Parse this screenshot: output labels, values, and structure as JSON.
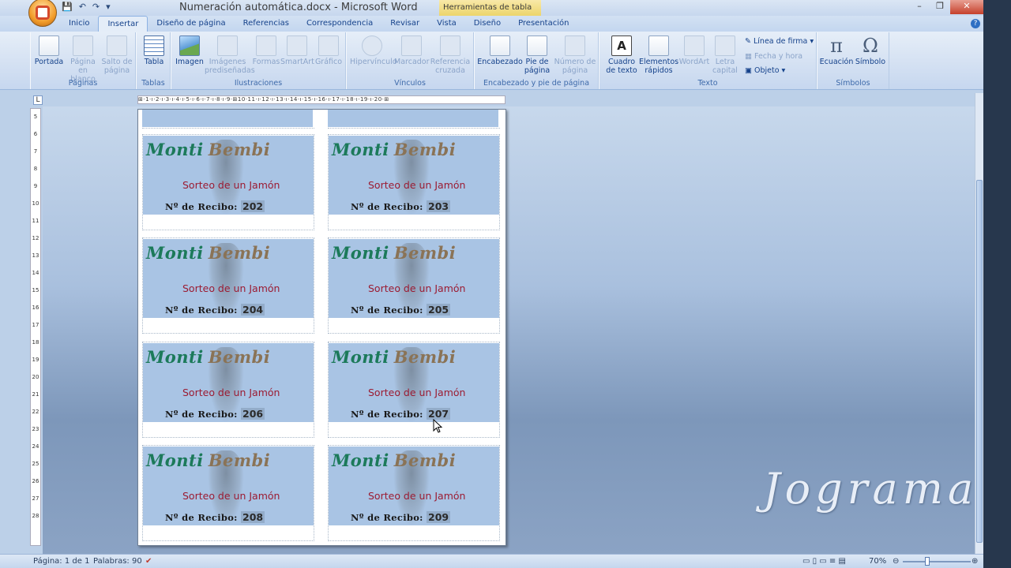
{
  "window": {
    "title": "Numeración automática.docx - Microsoft Word",
    "context_tab": "Herramientas de tabla",
    "controls": [
      "–",
      "❐",
      "✕"
    ]
  },
  "quick_access": [
    "💾",
    "↶",
    "↷",
    "▾"
  ],
  "tabs": [
    "Inicio",
    "Insertar",
    "Diseño de página",
    "Referencias",
    "Correspondencia",
    "Revisar",
    "Vista",
    "Diseño",
    "Presentación"
  ],
  "active_tab": "Insertar",
  "ribbon": {
    "groups": {
      "paginas": {
        "label": "Páginas",
        "buttons": [
          "Portada",
          "Página en blanco",
          "Salto de página"
        ]
      },
      "tablas": {
        "label": "Tablas",
        "buttons": [
          "Tabla"
        ]
      },
      "ilustraciones": {
        "label": "Ilustraciones",
        "buttons": [
          "Imagen",
          "Imágenes prediseñadas",
          "Formas",
          "SmartArt",
          "Gráfico"
        ]
      },
      "vinculos": {
        "label": "Vínculos",
        "buttons": [
          "Hipervínculo",
          "Marcador",
          "Referencia cruzada"
        ]
      },
      "encabezado": {
        "label": "Encabezado y pie de página",
        "buttons": [
          "Encabezado",
          "Pie de página",
          "Número de página"
        ]
      },
      "texto": {
        "label": "Texto",
        "buttons": [
          "Cuadro de texto",
          "Elementos rápidos",
          "WordArt",
          "Letra capital"
        ],
        "small": [
          "Línea de firma",
          "Fecha y hora",
          "Objeto"
        ]
      },
      "simbolos": {
        "label": "Símbolos",
        "buttons": [
          "Ecuación",
          "Símbolo"
        ]
      }
    }
  },
  "ruler": {
    "corner": "L",
    "horizontal": "⊞·1·ı·2·ı·3·ı·4·ı·5·ı·6·ı·7·ı·8·ı·9·⊞10·11·ı·12·ı·13·ı·14·ı·15·ı·16·ı·17·ı·18·ı·19·ı·20·⊞",
    "vertical": [
      "5",
      "6",
      "7",
      "8",
      "9",
      "10",
      "11",
      "12",
      "13",
      "14",
      "15",
      "16",
      "17",
      "18",
      "19",
      "20",
      "21",
      "22",
      "23",
      "24",
      "25",
      "26",
      "27",
      "28"
    ]
  },
  "tickets": {
    "brand_first": "Monti",
    "brand_second": "Bembi",
    "subtitle": "Sorteo de un Jamón",
    "receipt_label": "Nº de Recibo:",
    "numbers": [
      "202",
      "203",
      "204",
      "205",
      "206",
      "207",
      "208",
      "209"
    ]
  },
  "watermark": "Jograma",
  "status": {
    "page": "Página: 1 de 1",
    "words": "Palabras: 90",
    "zoom": "70%"
  }
}
